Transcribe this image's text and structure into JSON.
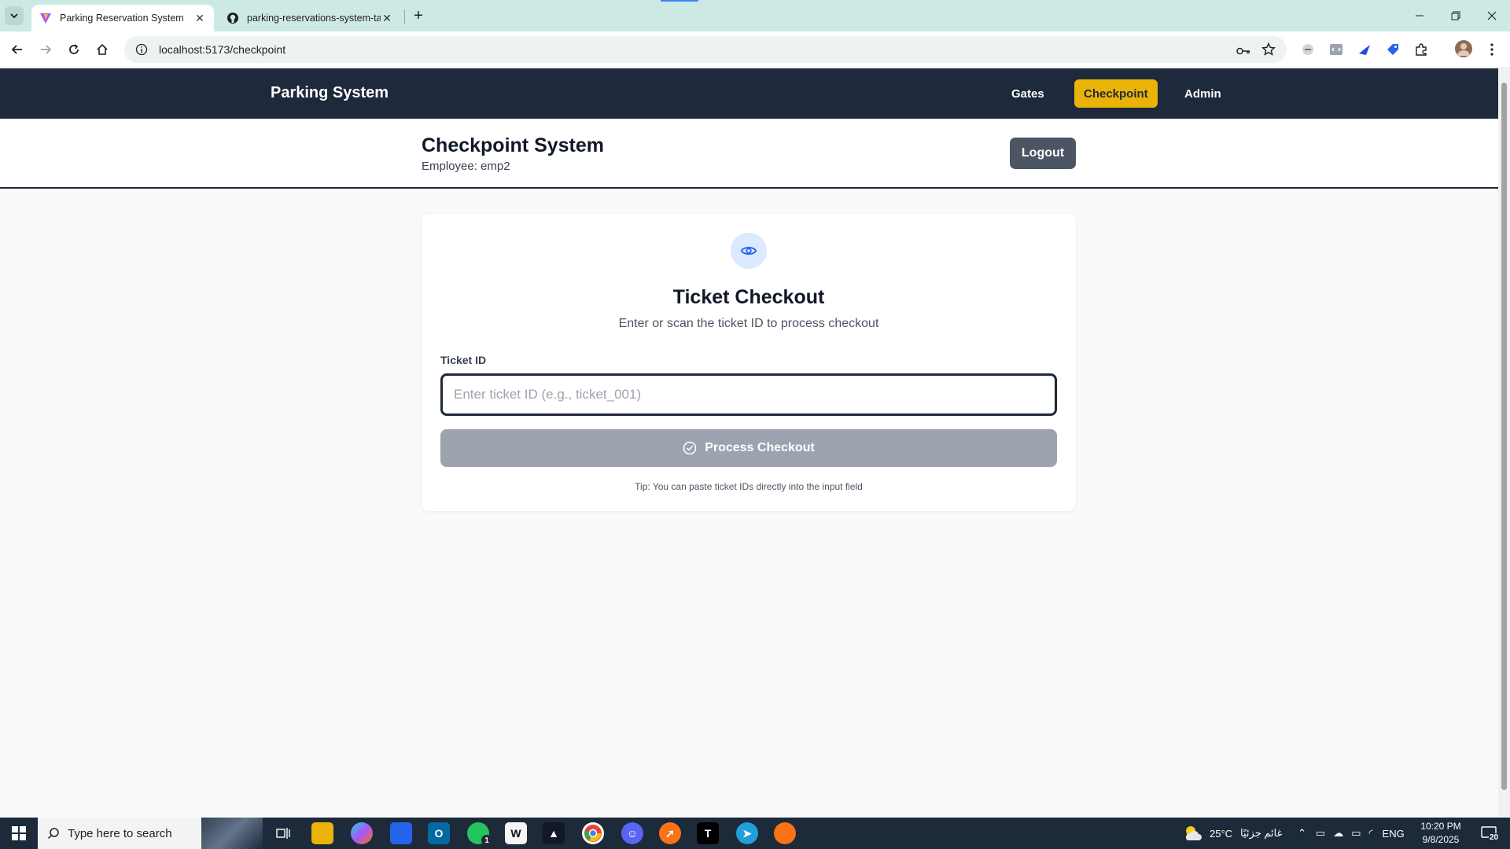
{
  "browser": {
    "tabs": [
      {
        "title": "Parking Reservation System",
        "active": true
      },
      {
        "title": "parking-reservations-system-ta",
        "active": false
      }
    ],
    "url": "localhost:5173/checkpoint"
  },
  "app": {
    "brand": "Parking System",
    "nav": [
      {
        "label": "Gates",
        "active": false
      },
      {
        "label": "Checkpoint",
        "active": true
      },
      {
        "label": "Admin",
        "active": false
      }
    ]
  },
  "header": {
    "title": "Checkpoint System",
    "employee": "Employee: emp2",
    "logout_label": "Logout"
  },
  "checkout": {
    "icon": "eye-icon",
    "title": "Ticket Checkout",
    "subtitle": "Enter or scan the ticket ID to process checkout",
    "field_label": "Ticket ID",
    "input_value": "",
    "input_placeholder": "Enter ticket ID (e.g., ticket_001)",
    "button_label": "Process Checkout",
    "tip": "Tip: You can paste ticket IDs directly into the input field"
  },
  "taskbar": {
    "search_placeholder": "Type here to search",
    "whatsapp_badge": "1",
    "weather": "25°C",
    "weather_text": "غائم جزئيًا",
    "language": "ENG",
    "time": "10:20 PM",
    "date": "9/8/2025",
    "notifications": "20"
  },
  "colors": {
    "nav_bg": "#1e293b",
    "active_nav": "#eab308",
    "logout_bg": "#4b5563",
    "disabled_button": "#9ca3af",
    "icon_circle": "#dbeafe",
    "icon_blue": "#2563eb"
  }
}
